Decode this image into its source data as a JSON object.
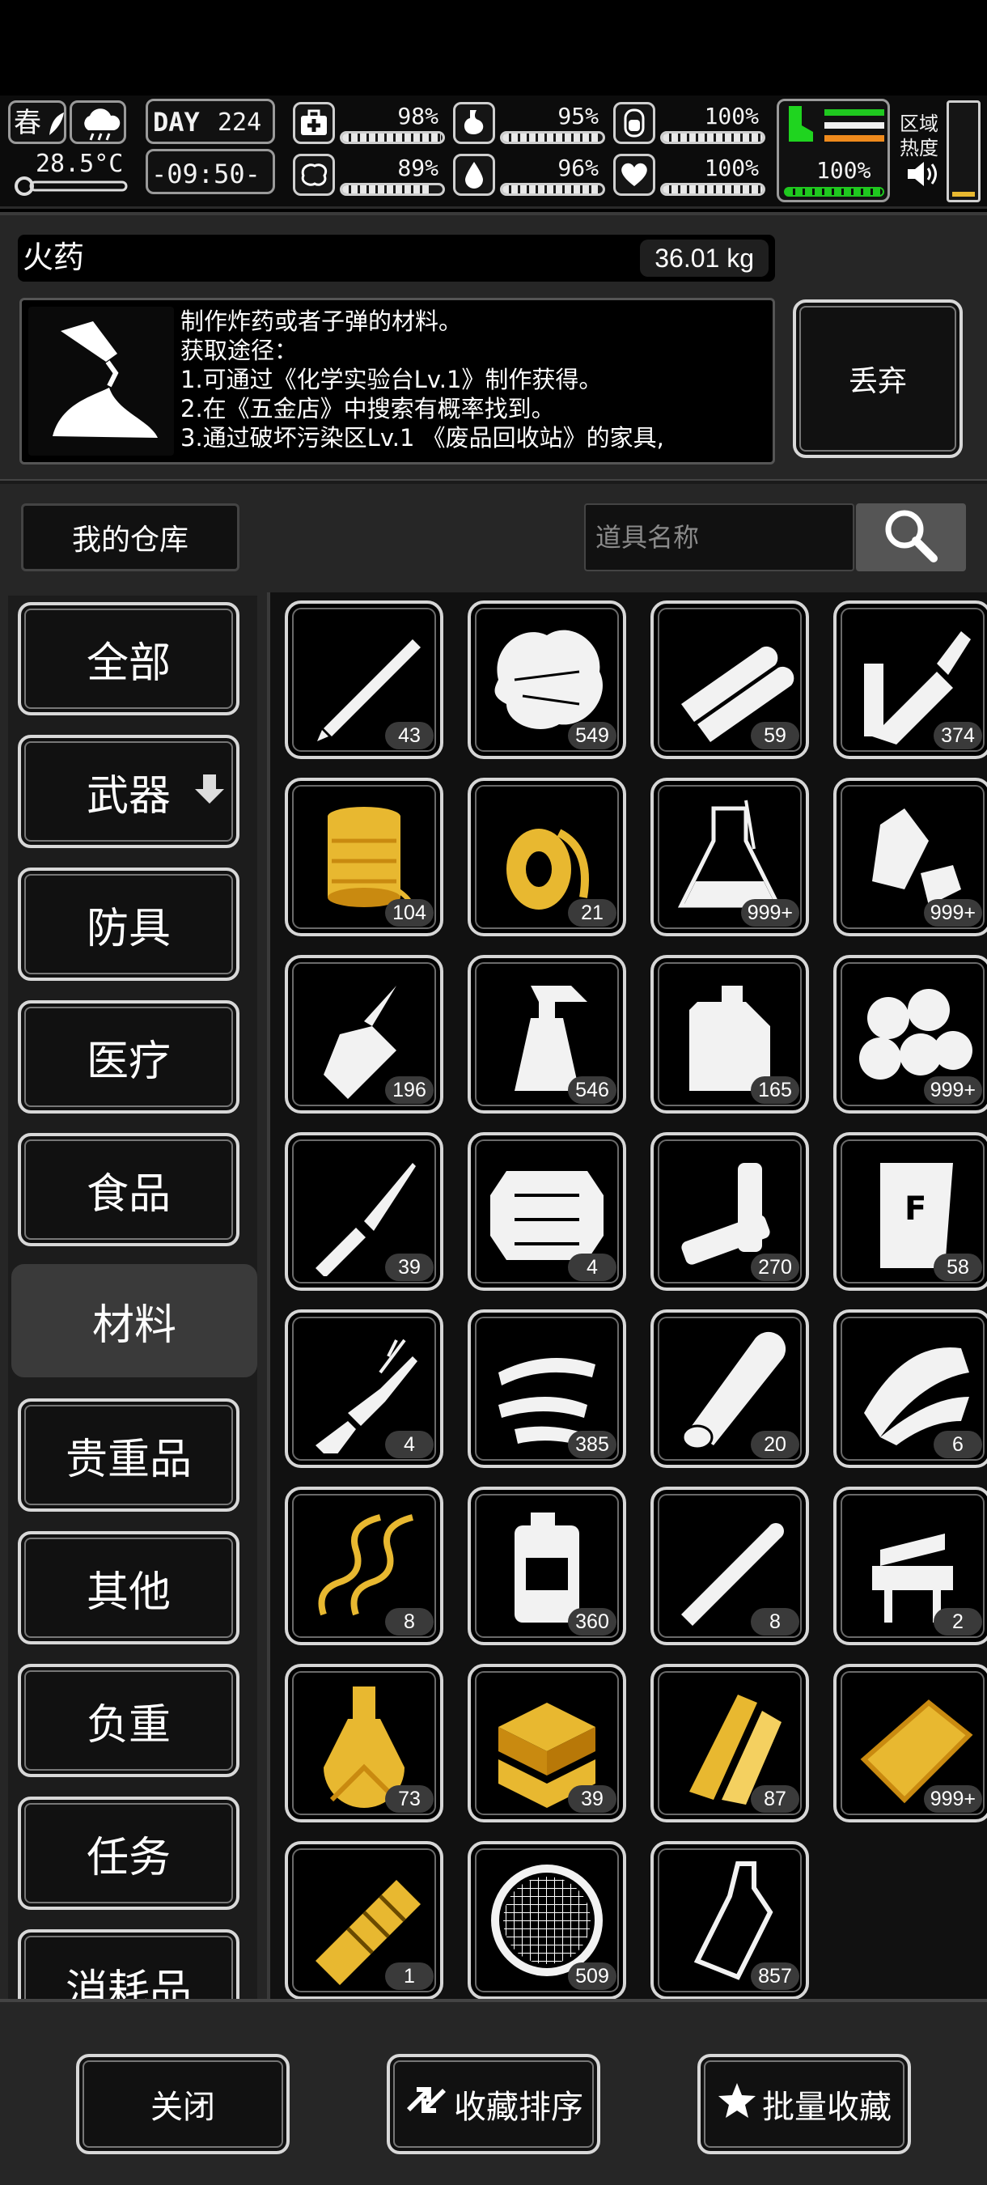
{
  "hud": {
    "season": "春",
    "temperature": "28.5°C",
    "day_label": "DAY",
    "day_number": "224",
    "time": "-09:50-",
    "region_heat_label": "区域\n热度",
    "stats": [
      {
        "name": "health",
        "value": "98%",
        "level": 0.98
      },
      {
        "name": "stomach",
        "value": "95%",
        "level": 0.95
      },
      {
        "name": "stamina",
        "value": "100%",
        "level": 1.0
      },
      {
        "name": "mental",
        "value": "89%",
        "level": 0.89
      },
      {
        "name": "water",
        "value": "96%",
        "level": 0.96
      },
      {
        "name": "heart",
        "value": "100%",
        "level": 1.0
      }
    ],
    "load_percent": "100%",
    "load_level": 1.0
  },
  "item": {
    "name": "火药",
    "weight": "36.01 kg",
    "description": "制作炸药或者子弹的材料。\n获取途径：\n1.可通过《化学实验台Lv.1》制作获得。\n2.在《五金店》中搜索有概率找到。\n3.通过破坏污染区Lv.1 《废品回收站》的家具,",
    "discard_label": "丢弃"
  },
  "warehouse": {
    "title": "我的仓库",
    "search_placeholder": "道具名称"
  },
  "categories": [
    {
      "label": "全部"
    },
    {
      "label": "武器"
    },
    {
      "label": "防具"
    },
    {
      "label": "医疗"
    },
    {
      "label": "食品"
    },
    {
      "label": "材料"
    },
    {
      "label": "贵重品"
    },
    {
      "label": "其他"
    },
    {
      "label": "负重"
    },
    {
      "label": "任务"
    },
    {
      "label": "消耗品"
    }
  ],
  "active_category": "材料",
  "items": [
    {
      "icon": "pipe-icon",
      "qty": "43"
    },
    {
      "icon": "cotton-icon",
      "qty": "549"
    },
    {
      "icon": "steel-tubes-icon",
      "qty": "59"
    },
    {
      "icon": "gunpowder-icon",
      "qty": "374"
    },
    {
      "icon": "thread-spool-icon",
      "qty": "104"
    },
    {
      "icon": "tape-roll-icon",
      "qty": "21"
    },
    {
      "icon": "flask-icon",
      "qty": "999+"
    },
    {
      "icon": "plastic-bottle-trash-icon",
      "qty": "999+"
    },
    {
      "icon": "glue-bottle-icon",
      "qty": "196"
    },
    {
      "icon": "spray-bottle-icon",
      "qty": "546"
    },
    {
      "icon": "jerrycan-icon",
      "qty": "165"
    },
    {
      "icon": "cotton-balls-icon",
      "qty": "999+"
    },
    {
      "icon": "screwdriver-icon",
      "qty": "39"
    },
    {
      "icon": "electronic-part-icon",
      "qty": "4"
    },
    {
      "icon": "battery-icon",
      "qty": "270"
    },
    {
      "icon": "fertilizer-bag-icon",
      "qty": "58"
    },
    {
      "icon": "broken-rifle-icon",
      "qty": "4"
    },
    {
      "icon": "leather-strips-icon",
      "qty": "385"
    },
    {
      "icon": "wood-log-icon",
      "qty": "20"
    },
    {
      "icon": "wood-planks-icon",
      "qty": "6"
    },
    {
      "icon": "copper-wire-icon",
      "qty": "8"
    },
    {
      "icon": "chemical-container-icon",
      "qty": "360"
    },
    {
      "icon": "metal-rod-icon",
      "qty": "8"
    },
    {
      "icon": "vise-icon",
      "qty": "2"
    },
    {
      "icon": "alchemy-flask-icon",
      "qty": "73"
    },
    {
      "icon": "gold-stack-icon",
      "qty": "39"
    },
    {
      "icon": "gold-wood-icon",
      "qty": "87"
    },
    {
      "icon": "gold-plate-icon",
      "qty": "999+"
    },
    {
      "icon": "gold-engine-icon",
      "qty": "1"
    },
    {
      "icon": "mesh-filter-icon",
      "qty": "509"
    },
    {
      "icon": "glass-bottle-icon",
      "qty": "857"
    }
  ],
  "bottom": {
    "close_label": "关闭",
    "sort_label": "收藏排序",
    "batch_fav_label": "批量收藏"
  },
  "colors": {
    "panel_bg": "#262626",
    "slot_border": "#d6d6d6",
    "gold": "#e8b830",
    "green": "#22c422",
    "orange": "#ef8a1c"
  }
}
